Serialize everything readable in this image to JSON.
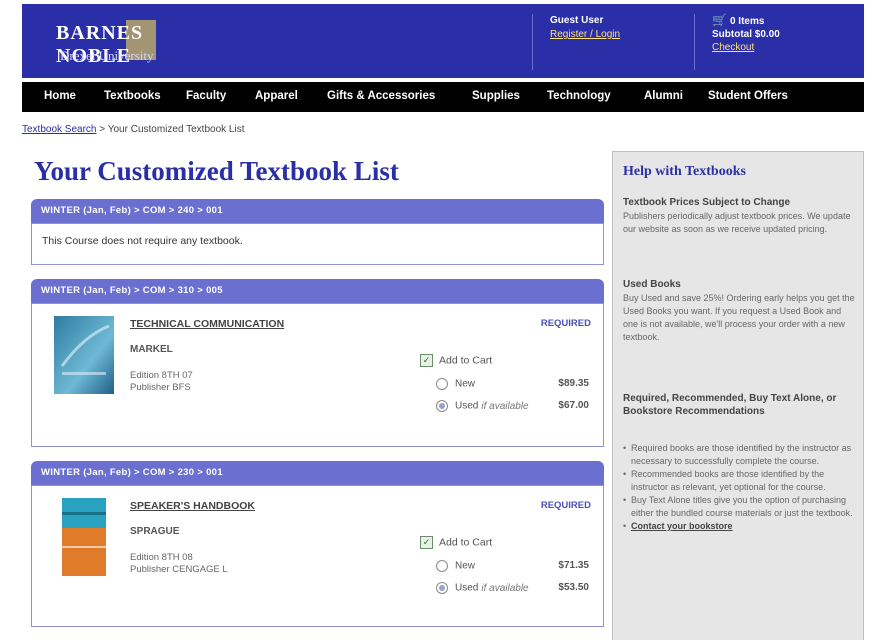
{
  "header": {
    "logo_line1": "BARNES NOBLE",
    "logo_line2": "Drexel University",
    "guest_label": "Guest User",
    "register_login": "Register / Login",
    "cart_items": "0 Items",
    "subtotal": "Subtotal $0.00",
    "checkout": "Checkout"
  },
  "nav": {
    "items": [
      "Home",
      "Textbooks",
      "Faculty",
      "Apparel",
      "Gifts & Accessories",
      "Supplies",
      "Technology",
      "Alumni",
      "Student Offers"
    ]
  },
  "breadcrumb": {
    "search": "Textbook Search",
    "separator": ">",
    "current": "Your Customized Textbook List"
  },
  "main": {
    "title": "Your Customized Textbook List",
    "courses": [
      {
        "header": "WINTER (Jan, Feb) > COM > 240 > 001",
        "message": "This Course does not require any textbook."
      },
      {
        "header": "WINTER (Jan, Feb) > COM > 310 > 005",
        "book": {
          "title": "TECHNICAL COMMUNICATION",
          "author": "MARKEL",
          "edition": "Edition 8TH 07",
          "publisher": "Publisher BFS",
          "requirement": "REQUIRED",
          "add_to_cart": "Add to Cart",
          "new_label": "New",
          "new_price": "$89.35",
          "used_label": "Used",
          "used_note": "if available",
          "used_price": "$67.00"
        }
      },
      {
        "header": "WINTER (Jan, Feb) > COM > 230 > 001",
        "book": {
          "title": "SPEAKER'S HANDBOOK",
          "author": "SPRAGUE",
          "edition": "Edition 8TH 08",
          "publisher": "Publisher CENGAGE L",
          "requirement": "REQUIRED",
          "add_to_cart": "Add to Cart",
          "new_label": "New",
          "new_price": "$71.35",
          "used_label": "Used",
          "used_note": "if available",
          "used_price": "$53.50"
        }
      }
    ]
  },
  "sidebar": {
    "title": "Help with Textbooks",
    "s1_heading": "Textbook Prices Subject to Change",
    "s1_text": "Publishers periodically adjust textbook prices. We update our website as soon as we receive updated pricing.",
    "s2_heading": "Used Books",
    "s2_text": "Buy Used and save 25%! Ordering early helps you get the Used Books you want. If you request a Used Book and one is not available, we'll process your order with a new textbook.",
    "s3_heading": "Required, Recommended, Buy Text Alone, or Bookstore Recommendations",
    "bullets": [
      "Required books are those identified by the instructor as necessary to successfully complete the course.",
      "Recommended books are those identified by the instructor as relevant, yet optional for the course.",
      "Buy Text Alone titles give you the option of purchasing either the bundled course materials or just the textbook."
    ],
    "contact_link": "Contact your bookstore"
  },
  "colors": {
    "brand_blue": "#2a2fa8",
    "course_header": "#6a6fd0",
    "nav_black": "#000000"
  }
}
